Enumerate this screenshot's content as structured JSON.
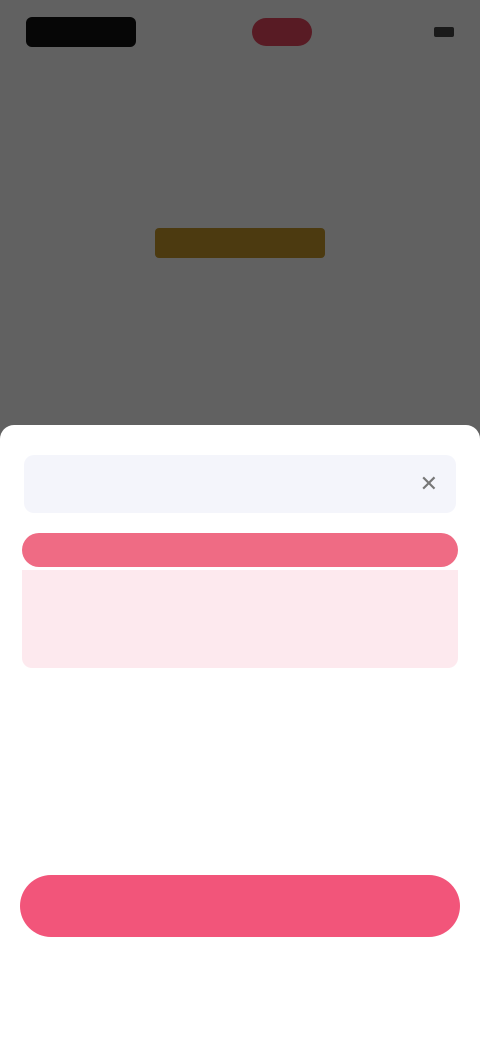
{
  "status_bar": {
    "logo_text": "",
    "time": ""
  },
  "background": {
    "title": "",
    "price": "",
    "description": "",
    "link_text": ""
  },
  "sheet": {
    "account_text": "",
    "banner_text": "",
    "plan_selected": {
      "name": "",
      "sub": "",
      "price": ""
    },
    "plan_other": {
      "line1": "",
      "line2": "",
      "line3": "",
      "price": ""
    },
    "total": {
      "label": "",
      "value": ""
    },
    "subscribe_label": "",
    "footer_link": ""
  },
  "colors": {
    "accent": "#f2557a",
    "banner": "#ef6b84",
    "selected_bg": "#fde9ee",
    "price_highlight": "#c99a2a"
  }
}
